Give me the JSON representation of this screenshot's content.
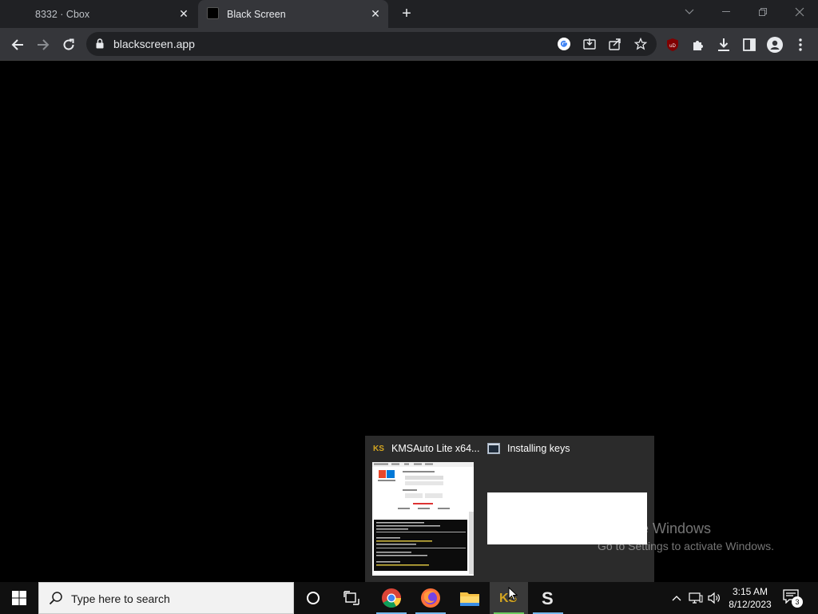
{
  "browser": {
    "tabs": [
      {
        "title": "8332 · Cbox",
        "active": false
      },
      {
        "title": "Black Screen",
        "active": true
      }
    ],
    "address": "blackscreen.app"
  },
  "preview": {
    "items": [
      {
        "title": "KMSAuto Lite x64..."
      },
      {
        "title": "Installing keys"
      }
    ]
  },
  "watermark": {
    "line1": "Activate Windows",
    "line2": "Go to Settings to activate Windows."
  },
  "taskbar": {
    "search_placeholder": "Type here to search",
    "clock_time": "3:15 AM",
    "clock_date": "8/12/2023",
    "notification_count": "3"
  },
  "colors": {
    "accent": "#76b9ed",
    "browser_frame": "#202124",
    "toolbar": "#35363a"
  }
}
